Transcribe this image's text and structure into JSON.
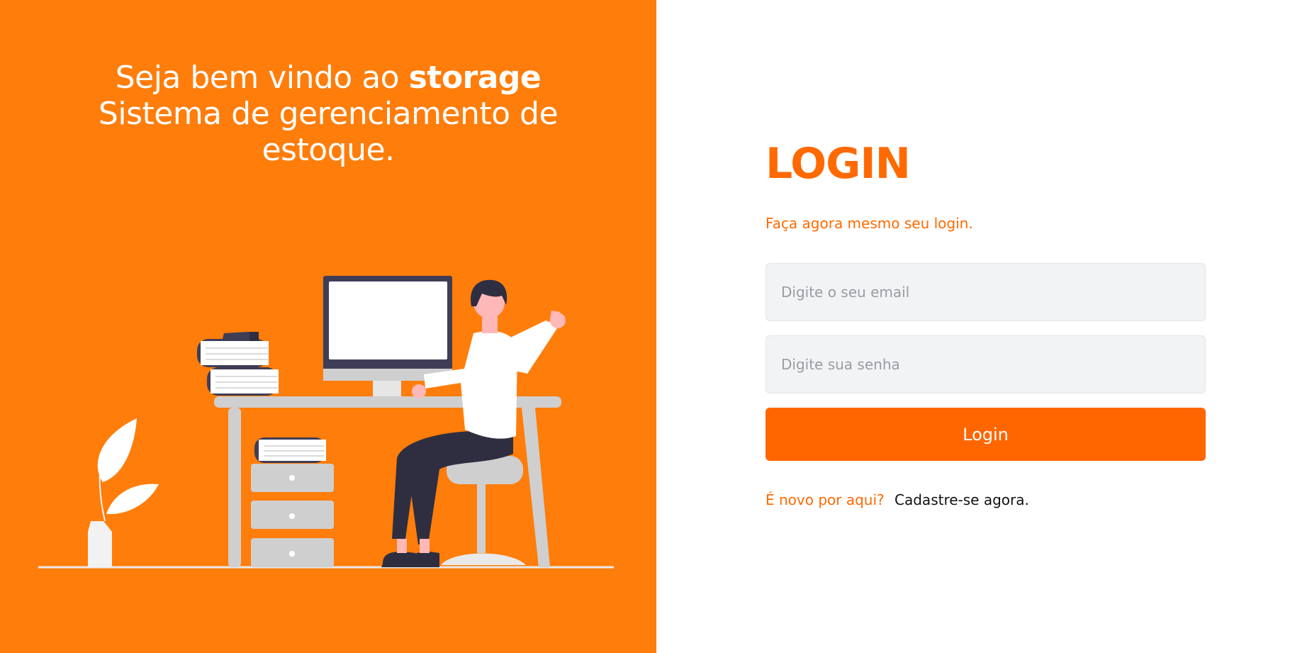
{
  "welcome": {
    "line1_prefix": "Seja bem vindo ao",
    "line1_brand": "storage",
    "line2": "Sistema de gerenciamento de",
    "line3": "estoque."
  },
  "login": {
    "title": "LOGIN",
    "subtitle": "Faça agora mesmo seu login.",
    "email_placeholder": "Digite o seu email",
    "password_placeholder": "Digite sua senha",
    "button_label": "Login",
    "signup_question": "É novo por aqui?",
    "signup_link": "Cadastre-se agora."
  },
  "colors": {
    "left_panel_bg": "#ff7d0a",
    "accent": "#ff6600",
    "input_bg": "#f2f3f5"
  },
  "icons": {
    "illustration": "person-at-desk-illustration"
  }
}
